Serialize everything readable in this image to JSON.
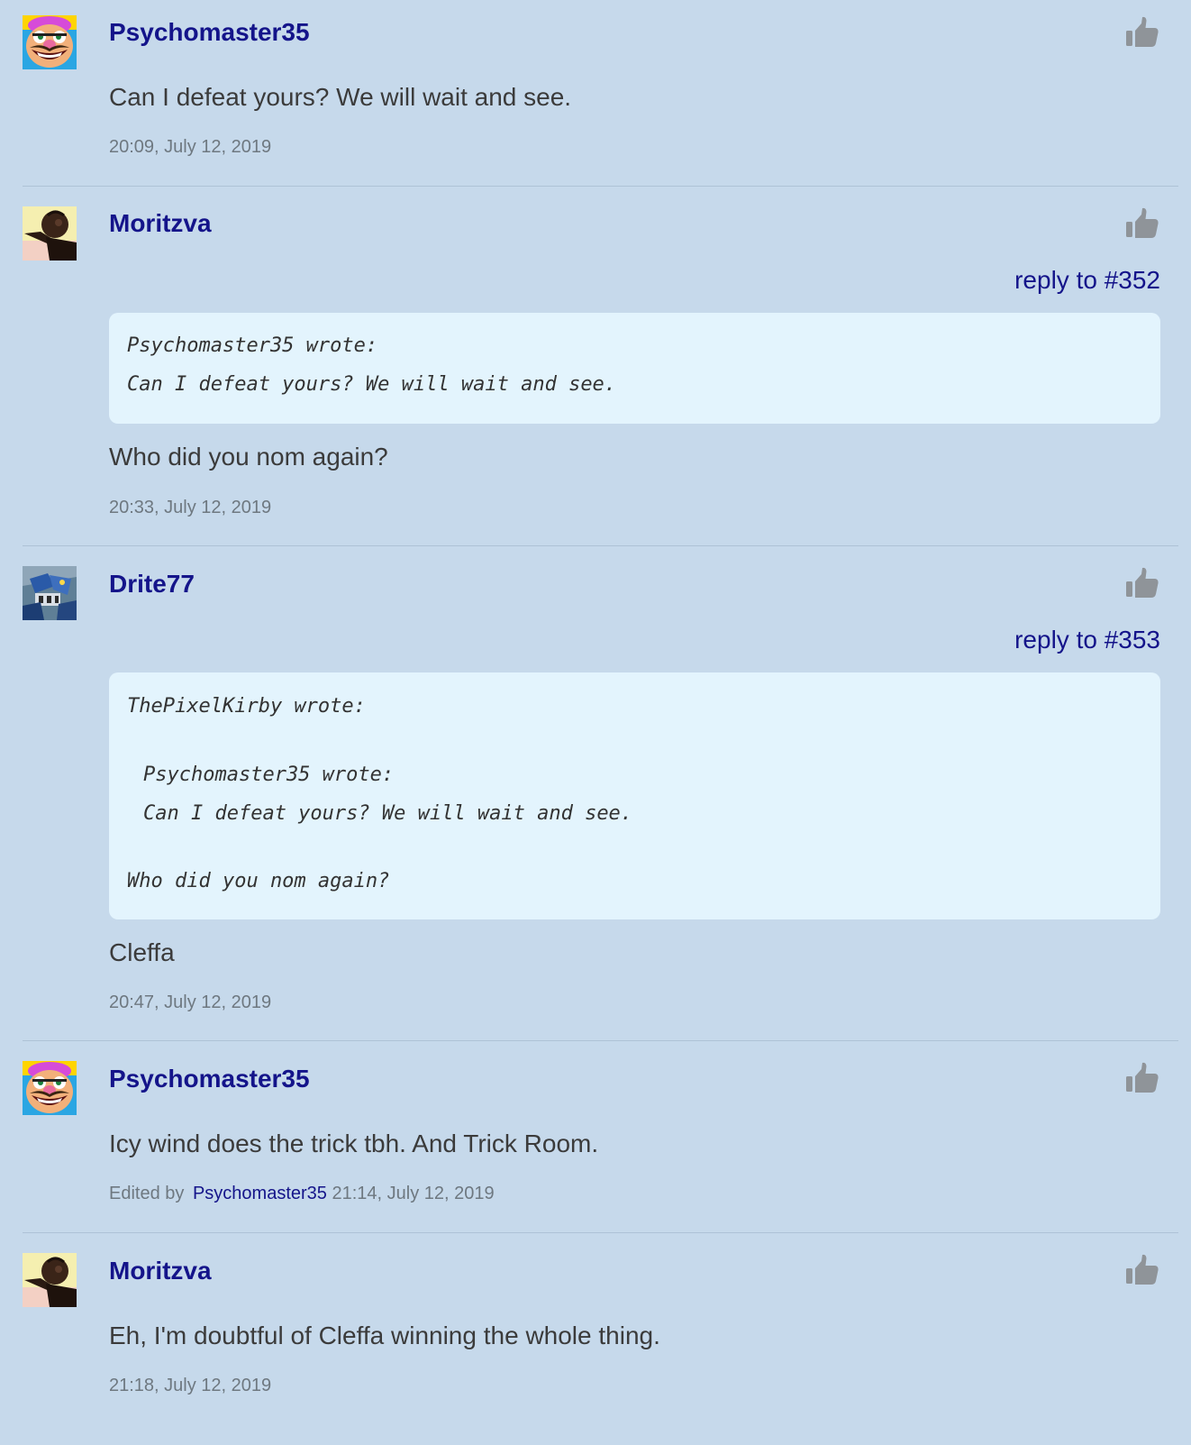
{
  "comments": [
    {
      "author": "Psychomaster35",
      "avatar_icon": "wario-avatar-icon",
      "body": "Can I defeat yours? We will wait and see.",
      "timestamp": "20:09, July 12, 2019"
    },
    {
      "author": "Moritzva",
      "avatar_icon": "silhouette-avatar-icon",
      "reply_link": "reply to #352",
      "quote": {
        "line1": "Psychomaster35 wrote:",
        "line2": "Can I defeat yours? We will wait and see."
      },
      "body": "Who did you nom again?",
      "timestamp": "20:33, July 12, 2019"
    },
    {
      "author": "Drite77",
      "avatar_icon": "robot-avatar-icon",
      "reply_link": "reply to #353",
      "quote": {
        "line1": "ThePixelKirby wrote:",
        "nested_line1": "Psychomaster35 wrote:",
        "nested_line2": "Can I defeat yours? We will wait and see.",
        "line_last": "Who did you nom again?"
      },
      "body": "Cleffa",
      "timestamp": "20:47, July 12, 2019"
    },
    {
      "author": "Psychomaster35",
      "avatar_icon": "wario-avatar-icon",
      "body": "Icy wind does the trick tbh. And Trick Room.",
      "edited_label": "Edited by",
      "edited_by": "Psychomaster35",
      "timestamp": "21:14, July 12, 2019"
    },
    {
      "author": "Moritzva",
      "avatar_icon": "silhouette-avatar-icon",
      "body": "Eh, I'm doubtful of Cleffa winning the whole thing.",
      "timestamp": "21:18, July 12, 2019"
    }
  ],
  "colors": {
    "background": "#c6d9eb",
    "author_link": "#14148a",
    "quote_background": "#e3f4fd",
    "like_icon": "#8f9499"
  },
  "like_icon": "thumbs-up-icon"
}
